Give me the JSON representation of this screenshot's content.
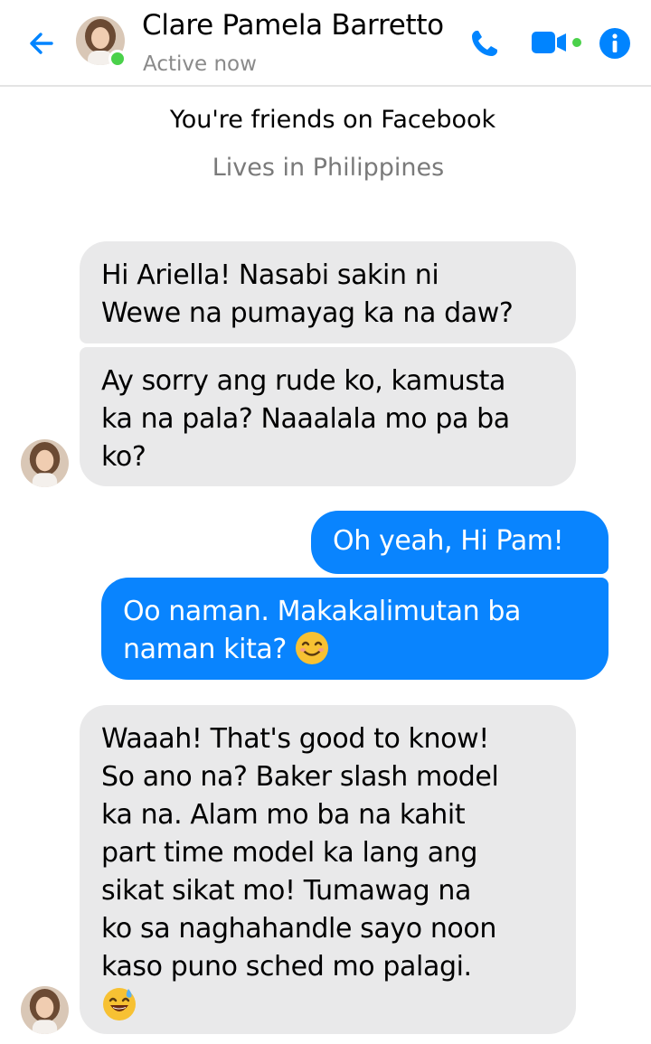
{
  "header": {
    "name": "Clare Pamela Barretto",
    "status": "Active now",
    "icons": {
      "back": "back-arrow-icon",
      "call": "phone-icon",
      "video": "video-camera-icon",
      "info": "info-icon"
    },
    "accent_color": "#0084ff",
    "online_color": "#4ad14a"
  },
  "intro": {
    "friends_text": "You're friends on Facebook",
    "location_text": "Lives in Philippines"
  },
  "messages": [
    {
      "direction": "incoming",
      "lines": [
        "Hi Ariella! Nasabi sakin ni",
        "Wewe na pumayag ka na daw?"
      ]
    },
    {
      "direction": "incoming",
      "lines": [
        "Ay sorry ang rude ko, kamusta",
        "ka na pala? Naaalala mo pa ba",
        "ko?"
      ]
    },
    {
      "direction": "outgoing",
      "lines": [
        "Oh yeah, Hi Pam!"
      ]
    },
    {
      "direction": "outgoing",
      "lines": [
        "Oo naman. Makakalimutan ba",
        "naman kita?"
      ],
      "emoji": "smiling-face-emoji"
    },
    {
      "direction": "incoming",
      "lines": [
        "Waaah! That's good to know!",
        "So ano na? Baker slash model",
        "ka na. Alam mo ba na kahit",
        "part time model ka lang ang",
        "sikat sikat mo! Tumawag na",
        "ko sa naghahandle sayo noon",
        "kaso puno sched mo palagi."
      ],
      "emoji": "grinning-sweat-emoji"
    }
  ],
  "colors": {
    "incoming_bubble": "#e9e9ea",
    "outgoing_bubble": "#0984fe"
  }
}
